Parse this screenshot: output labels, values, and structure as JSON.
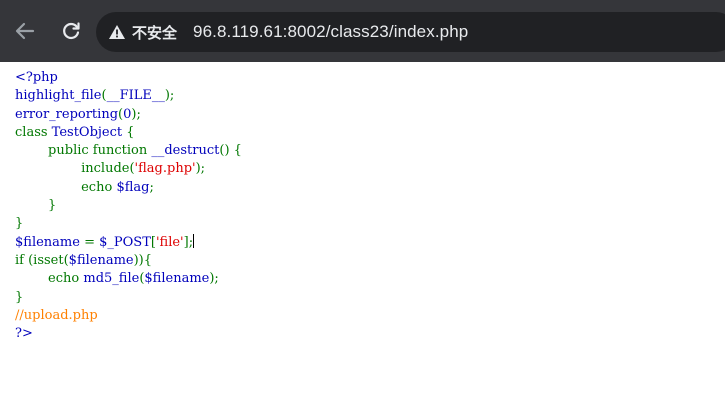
{
  "browser": {
    "security_label": "不安全",
    "url": "96.8.119.61:8002/class23/index.php",
    "back_icon": "back-arrow-icon",
    "reload_icon": "reload-icon",
    "warning_icon": "warning-triangle-icon"
  },
  "colors": {
    "default": "#0000bb",
    "keyword": "#007700",
    "string": "#dd0000",
    "comment": "#ff8000"
  },
  "code_lines": [
    [
      {
        "t": "default",
        "v": "<?php"
      }
    ],
    [
      {
        "t": "default",
        "v": "highlight_file"
      },
      {
        "t": "keyword",
        "v": "("
      },
      {
        "t": "default",
        "v": "__FILE__"
      },
      {
        "t": "keyword",
        "v": ");"
      }
    ],
    [
      {
        "t": "default",
        "v": "error_reporting"
      },
      {
        "t": "keyword",
        "v": "("
      },
      {
        "t": "default",
        "v": "0"
      },
      {
        "t": "keyword",
        "v": ");"
      }
    ],
    [
      {
        "t": "keyword",
        "v": "class "
      },
      {
        "t": "default",
        "v": "TestObject "
      },
      {
        "t": "keyword",
        "v": "{"
      }
    ],
    [
      {
        "t": "keyword",
        "v": "        public function "
      },
      {
        "t": "default",
        "v": "__destruct"
      },
      {
        "t": "keyword",
        "v": "() {"
      }
    ],
    [
      {
        "t": "keyword",
        "v": "                include("
      },
      {
        "t": "string",
        "v": "'flag.php'"
      },
      {
        "t": "keyword",
        "v": ");"
      }
    ],
    [
      {
        "t": "keyword",
        "v": "                echo "
      },
      {
        "t": "default",
        "v": "$flag"
      },
      {
        "t": "keyword",
        "v": ";"
      }
    ],
    [
      {
        "t": "keyword",
        "v": "        }"
      }
    ],
    [
      {
        "t": "keyword",
        "v": "}"
      }
    ],
    [
      {
        "t": "default",
        "v": "$filename "
      },
      {
        "t": "keyword",
        "v": "= "
      },
      {
        "t": "default",
        "v": "$_POST"
      },
      {
        "t": "keyword",
        "v": "["
      },
      {
        "t": "string",
        "v": "'file'"
      },
      {
        "t": "keyword",
        "v": "];"
      },
      {
        "t": "caret",
        "v": ""
      }
    ],
    [
      {
        "t": "keyword",
        "v": "if (isset("
      },
      {
        "t": "default",
        "v": "$filename"
      },
      {
        "t": "keyword",
        "v": ")){"
      }
    ],
    [
      {
        "t": "keyword",
        "v": "        echo "
      },
      {
        "t": "default",
        "v": "md5_file"
      },
      {
        "t": "keyword",
        "v": "("
      },
      {
        "t": "default",
        "v": "$filename"
      },
      {
        "t": "keyword",
        "v": ");"
      }
    ],
    [
      {
        "t": "keyword",
        "v": "}"
      }
    ],
    [
      {
        "t": "comment",
        "v": "//upload.php"
      }
    ],
    [
      {
        "t": "default",
        "v": "?>"
      }
    ]
  ]
}
